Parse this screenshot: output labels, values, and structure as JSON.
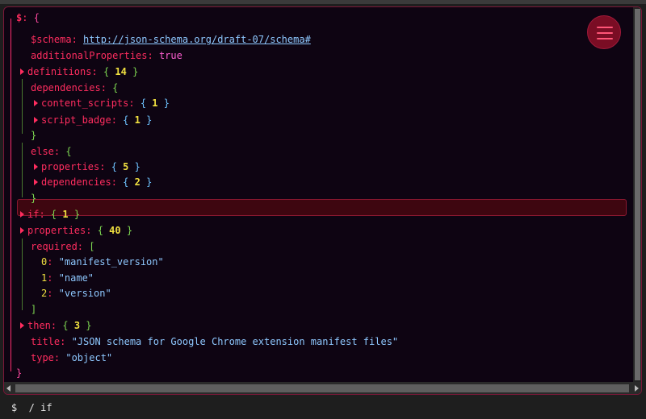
{
  "tree": {
    "root": {
      "key": "$",
      "open": "{",
      "close": "}"
    },
    "schema": {
      "key": "$schema",
      "value": "http://json-schema.org/draft-07/schema#"
    },
    "additionalProperties": {
      "key": "additionalProperties",
      "value": "true"
    },
    "definitions": {
      "key": "definitions",
      "count": "14"
    },
    "dependencies": {
      "key": "dependencies",
      "children": [
        {
          "key": "content_scripts",
          "count": "1"
        },
        {
          "key": "script_badge",
          "count": "1"
        }
      ]
    },
    "else": {
      "key": "else",
      "children": [
        {
          "key": "properties",
          "count": "5"
        },
        {
          "key": "dependencies",
          "count": "2"
        }
      ]
    },
    "if": {
      "key": "if",
      "count": "1"
    },
    "properties": {
      "key": "properties",
      "count": "40"
    },
    "required": {
      "key": "required",
      "open": "[",
      "close": "]",
      "items": [
        {
          "index": "0",
          "value": "\"manifest_version\""
        },
        {
          "index": "1",
          "value": "\"name\""
        },
        {
          "index": "2",
          "value": "\"version\""
        }
      ]
    },
    "then": {
      "key": "then",
      "count": "3"
    },
    "title": {
      "key": "title",
      "value": "\"JSON schema for Google Chrome extension manifest files\""
    },
    "type": {
      "key": "type",
      "value": "\"object\""
    }
  },
  "status": {
    "path": "$  / if"
  },
  "colors": {
    "accent": "#ff2d5f",
    "highlight": "#3e0610",
    "background": "#0e0412"
  },
  "icons": {
    "menu": "hamburger-menu-icon",
    "collapsed": "caret-right-icon"
  }
}
